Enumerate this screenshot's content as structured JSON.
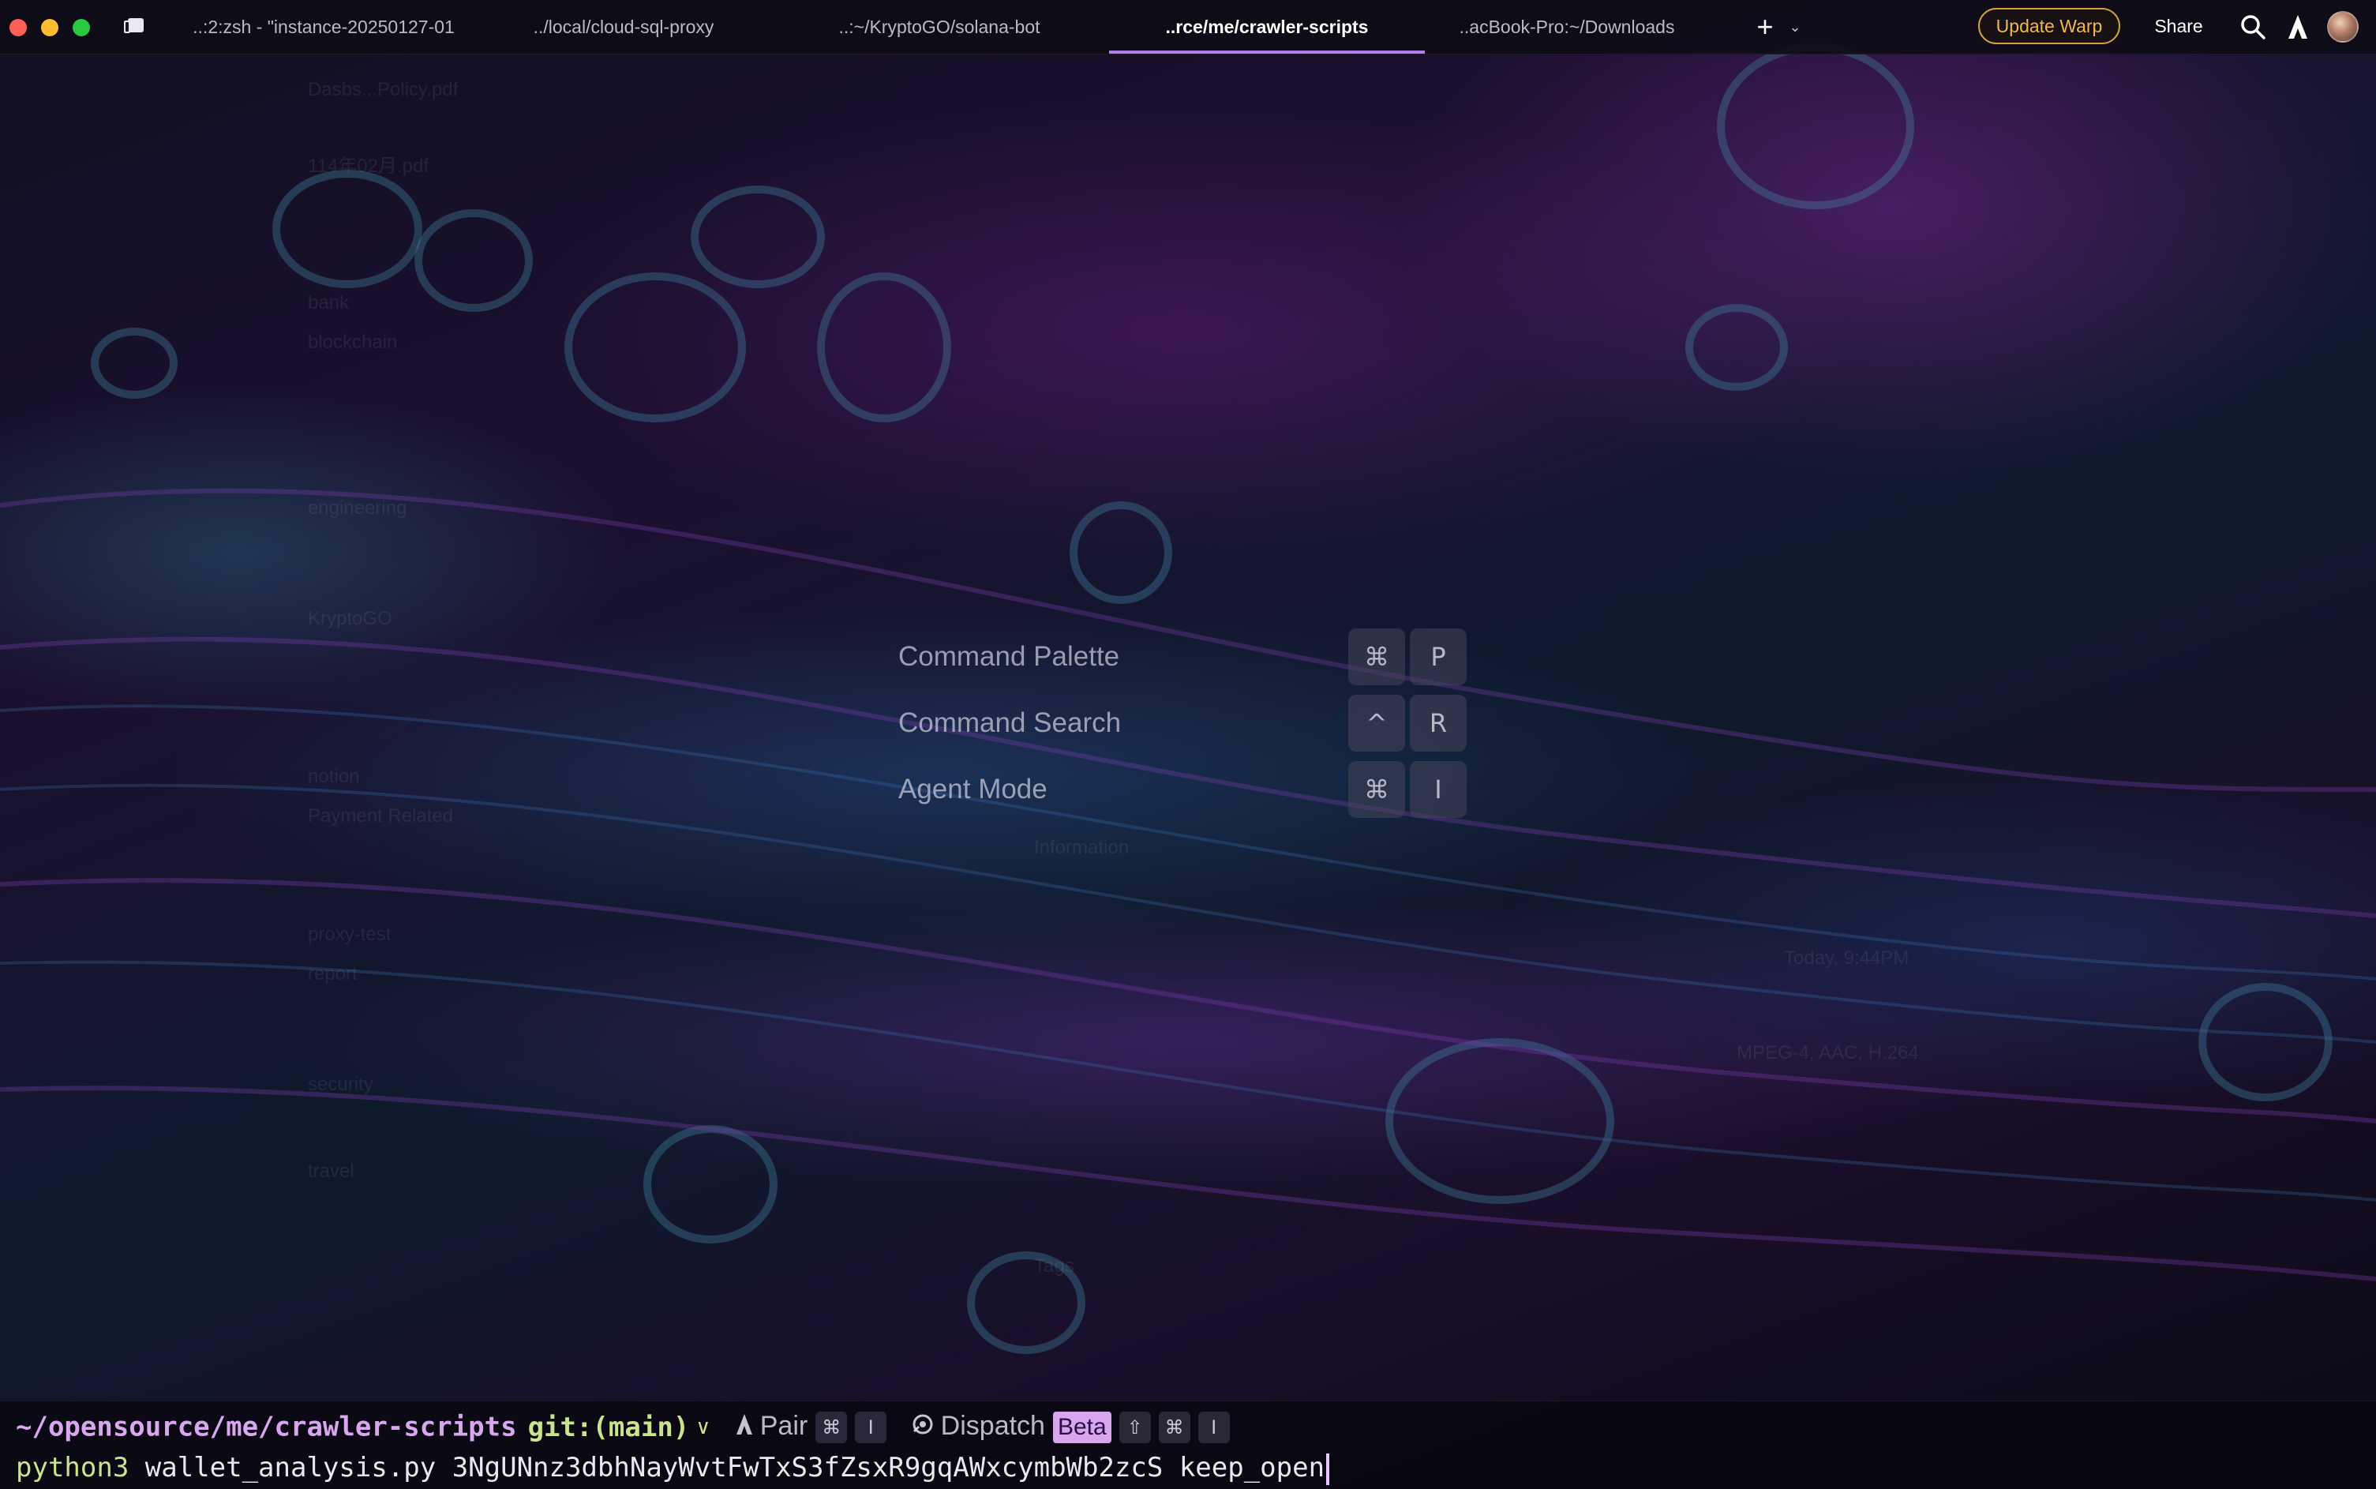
{
  "window": {
    "tabs": [
      {
        "label": "..:2:zsh - \"instance-20250127-01",
        "active": false
      },
      {
        "label": "../local/cloud-sql-proxy",
        "active": false
      },
      {
        "label": "..:~/KryptoGO/solana-bot",
        "active": false
      },
      {
        "label": "..rce/me/crawler-scripts",
        "active": true
      },
      {
        "label": "..acBook-Pro:~/Downloads",
        "active": false
      }
    ],
    "new_tab_symbol": "+",
    "dropdown_symbol": "⌄",
    "update_label": "Update Warp",
    "share_label": "Share"
  },
  "hints": [
    {
      "label": "Command Palette",
      "keys": [
        "⌘",
        "P"
      ]
    },
    {
      "label": "Command Search",
      "keys": [
        "^",
        "R"
      ]
    },
    {
      "label": "Agent Mode",
      "keys": [
        "⌘",
        "I"
      ]
    }
  ],
  "prompt": {
    "cwd": "~/opensource/me/crawler-scripts",
    "git": "git:(main)",
    "git_chevron": "∨",
    "pair": {
      "label": "Pair",
      "keys": [
        "⌘",
        "I"
      ]
    },
    "dispatch": {
      "label": "Dispatch",
      "badge": "Beta",
      "keys": [
        "⇧",
        "⌘",
        "I"
      ]
    }
  },
  "command": {
    "name": "python3",
    "args": " wallet_analysis.py 3NgUNnz3dbhNayWvtFwTxS3fZsxR9gqAWxcymbWb2zcS keep_open"
  },
  "colors": {
    "accent": "#b57cf0",
    "update_border": "#d4a33a",
    "cwd": "#d9a6f0",
    "git": "#c9e48a"
  },
  "icons": {
    "search": "magnifier",
    "agent": "warp-agent",
    "avatar": "user-avatar"
  }
}
